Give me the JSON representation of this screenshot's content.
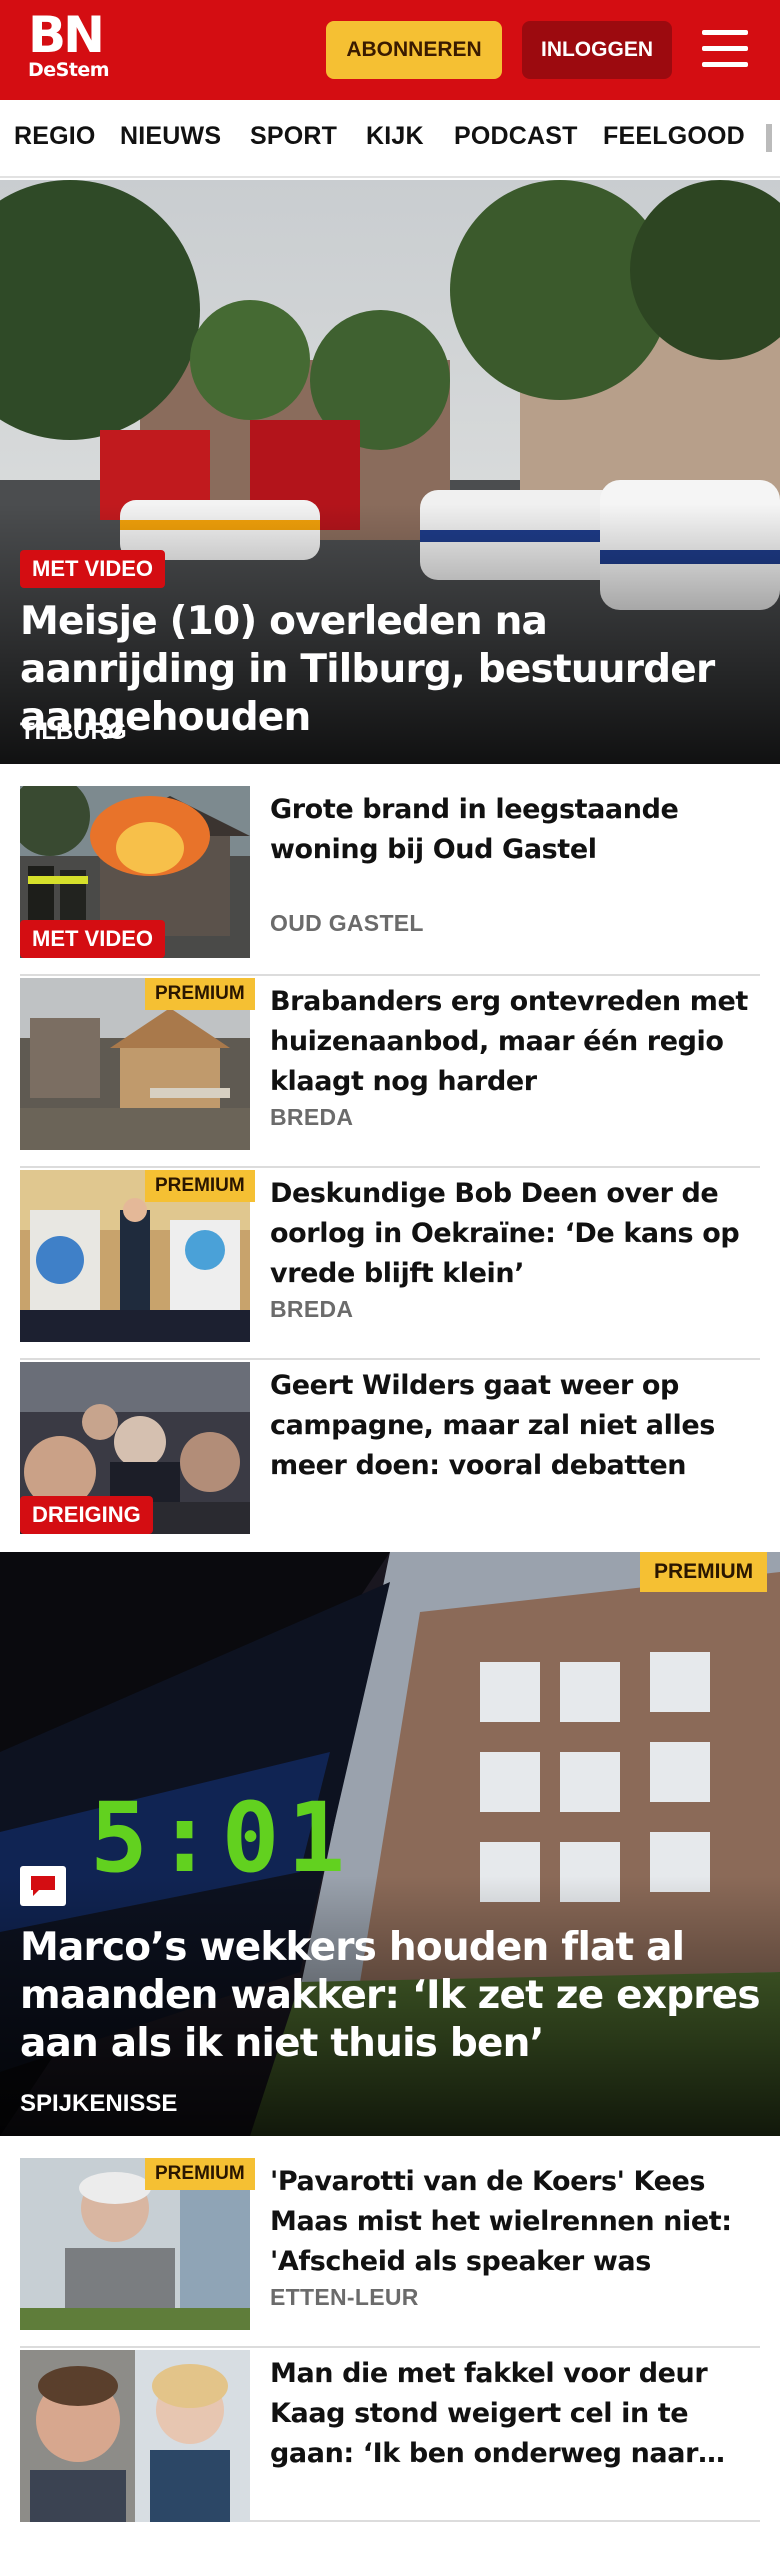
{
  "header": {
    "logo_main": "BN",
    "logo_sub": "DeStem",
    "subscribe_label": "ABONNEREN",
    "login_label": "INLOGGEN",
    "brand_color": "#d40d12",
    "accent_color": "#f5c033"
  },
  "nav": {
    "items": [
      "REGIO",
      "NIEUWS",
      "SPORT",
      "KIJK",
      "PODCAST",
      "FEELGOOD"
    ]
  },
  "hero_top": {
    "badge": "MET VIDEO",
    "title": "Meisje (10) overleden na aanrijding in Tilburg, bestuurder aangehouden",
    "location": "TILBURG"
  },
  "articles_a": [
    {
      "title": "Grote brand in leegstaande woning bij Oud Gastel",
      "location": "OUD GASTEL",
      "badge": "MET VIDEO",
      "premium": false
    },
    {
      "title": "Brabanders erg ontevreden met huizenaanbod, maar één regio klaagt nog harder",
      "location": "BREDA",
      "premium_label": "PREMIUM"
    },
    {
      "title": "Deskundige Bob Deen over de oorlog in Oekraïne: ‘De kans op vrede blijft klein’",
      "location": "BREDA",
      "premium_label": "PREMIUM"
    },
    {
      "title": "Geert Wilders gaat weer op campagne, maar zal niet alles meer doen: vooral debatten en…",
      "location": "",
      "badge": "DREIGING"
    }
  ],
  "hero_second": {
    "premium_label": "PREMIUM",
    "clock_text": "5:01",
    "title": "Marco’s wekkers houden flat al maanden wakker: ‘Ik zet ze expres aan als ik niet thuis ben’",
    "location": "SPIJKENISSE",
    "icon": "comment-icon"
  },
  "articles_b": [
    {
      "title": "'Pavarotti van de Koers' Kees Maas mist het wielrennen niet: 'Afscheid als speaker was mijn…",
      "location": "ETTEN-LEUR",
      "premium_label": "PREMIUM"
    },
    {
      "title": "Man die met fakkel voor deur Kaag stond weigert cel in te gaan: ‘Ik ben onderweg naar…",
      "location": ""
    }
  ]
}
